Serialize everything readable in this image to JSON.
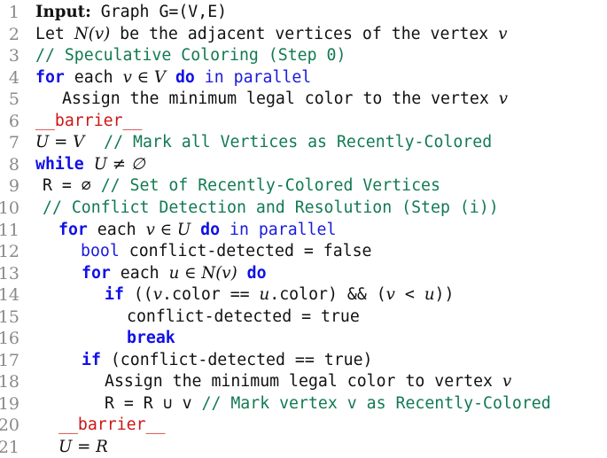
{
  "listing": {
    "lines": [
      {
        "num": "1",
        "parts": [
          {
            "t": "Input:",
            "c": "bold"
          },
          {
            "t": " Graph G=(V,E)",
            "c": ""
          }
        ]
      },
      {
        "num": "2",
        "parts": [
          {
            "t": "Let ",
            "c": ""
          },
          {
            "t": "N(v)",
            "c": "math"
          },
          {
            "t": " be the adjacent vertices of the vertex ",
            "c": ""
          },
          {
            "t": "v",
            "c": "math"
          }
        ]
      },
      {
        "num": "3",
        "parts": [
          {
            "t": "// Speculative Coloring (Step 0)",
            "c": "cm"
          }
        ]
      },
      {
        "num": "4",
        "parts": [
          {
            "t": "for",
            "c": "kw"
          },
          {
            "t": " each ",
            "c": ""
          },
          {
            "t": "v ∈ V",
            "c": "math"
          },
          {
            "t": " ",
            "c": ""
          },
          {
            "t": "do",
            "c": "kw"
          },
          {
            "t": " in parallel",
            "c": "kwn"
          }
        ]
      },
      {
        "num": "5",
        "parts": [
          {
            "t": "Assign the minimum legal color to the vertex ",
            "c": ""
          },
          {
            "t": "v",
            "c": "math"
          }
        ]
      },
      {
        "num": "6",
        "parts": [
          {
            "t": "__barrier__",
            "c": "rd"
          }
        ]
      },
      {
        "num": "7",
        "parts": [
          {
            "t": "U = V",
            "c": "math"
          },
          {
            "t": "  // Mark all Vertices as Recently-Colored",
            "c": "cm"
          }
        ]
      },
      {
        "num": "8",
        "parts": [
          {
            "t": "while",
            "c": "kw"
          },
          {
            "t": " ",
            "c": ""
          },
          {
            "t": "U ≠ ∅",
            "c": "math"
          }
        ]
      },
      {
        "num": "9",
        "parts": [
          {
            "t": "R = ∅ ",
            "c": ""
          },
          {
            "t": "// Set of Recently-Colored Vertices",
            "c": "cm"
          }
        ]
      },
      {
        "num": "10",
        "parts": [
          {
            "t": "// Conflict Detection and Resolution (Step (i))",
            "c": "cm"
          }
        ]
      },
      {
        "num": "11",
        "parts": [
          {
            "t": "for",
            "c": "kw"
          },
          {
            "t": " each ",
            "c": ""
          },
          {
            "t": "v ∈ U",
            "c": "math"
          },
          {
            "t": " ",
            "c": ""
          },
          {
            "t": "do",
            "c": "kw"
          },
          {
            "t": " in parallel",
            "c": "kwn"
          }
        ]
      },
      {
        "num": "12",
        "parts": [
          {
            "t": "bool",
            "c": "kwn"
          },
          {
            "t": " conflict-detected = false",
            "c": ""
          }
        ]
      },
      {
        "num": "13",
        "parts": [
          {
            "t": "for",
            "c": "kw"
          },
          {
            "t": " each ",
            "c": ""
          },
          {
            "t": "u ∈ N(v)",
            "c": "math"
          },
          {
            "t": " ",
            "c": ""
          },
          {
            "t": "do",
            "c": "kw"
          }
        ]
      },
      {
        "num": "14",
        "parts": [
          {
            "t": "if",
            "c": "kw"
          },
          {
            "t": " ((",
            "c": ""
          },
          {
            "t": "v",
            "c": "math"
          },
          {
            "t": ".color == ",
            "c": ""
          },
          {
            "t": "u",
            "c": "math"
          },
          {
            "t": ".color) && (",
            "c": ""
          },
          {
            "t": "v",
            "c": "math"
          },
          {
            "t": " < ",
            "c": ""
          },
          {
            "t": "u",
            "c": "math"
          },
          {
            "t": "))",
            "c": ""
          }
        ]
      },
      {
        "num": "15",
        "parts": [
          {
            "t": "conflict-detected = true",
            "c": ""
          }
        ]
      },
      {
        "num": "16",
        "parts": [
          {
            "t": "break",
            "c": "kw"
          }
        ]
      },
      {
        "num": "17",
        "parts": [
          {
            "t": "if",
            "c": "kw"
          },
          {
            "t": " (conflict-detected == true)",
            "c": ""
          }
        ]
      },
      {
        "num": "18",
        "parts": [
          {
            "t": "Assign the minimum legal color to vertex ",
            "c": ""
          },
          {
            "t": "v",
            "c": "math"
          }
        ]
      },
      {
        "num": "19",
        "parts": [
          {
            "t": "R = R ∪ v ",
            "c": ""
          },
          {
            "t": "// Mark vertex v as Recently-Colored",
            "c": "cm"
          }
        ]
      },
      {
        "num": "20",
        "parts": [
          {
            "t": "__barrier__",
            "c": "rd"
          }
        ]
      },
      {
        "num": "21",
        "parts": [
          {
            "t": "U = R",
            "c": "math"
          }
        ]
      }
    ]
  },
  "colors": {
    "keyword": "#1010e6",
    "comment": "#117a52",
    "barrier": "#cc1616",
    "line_number": "#8a8a8a",
    "text": "#111111"
  }
}
